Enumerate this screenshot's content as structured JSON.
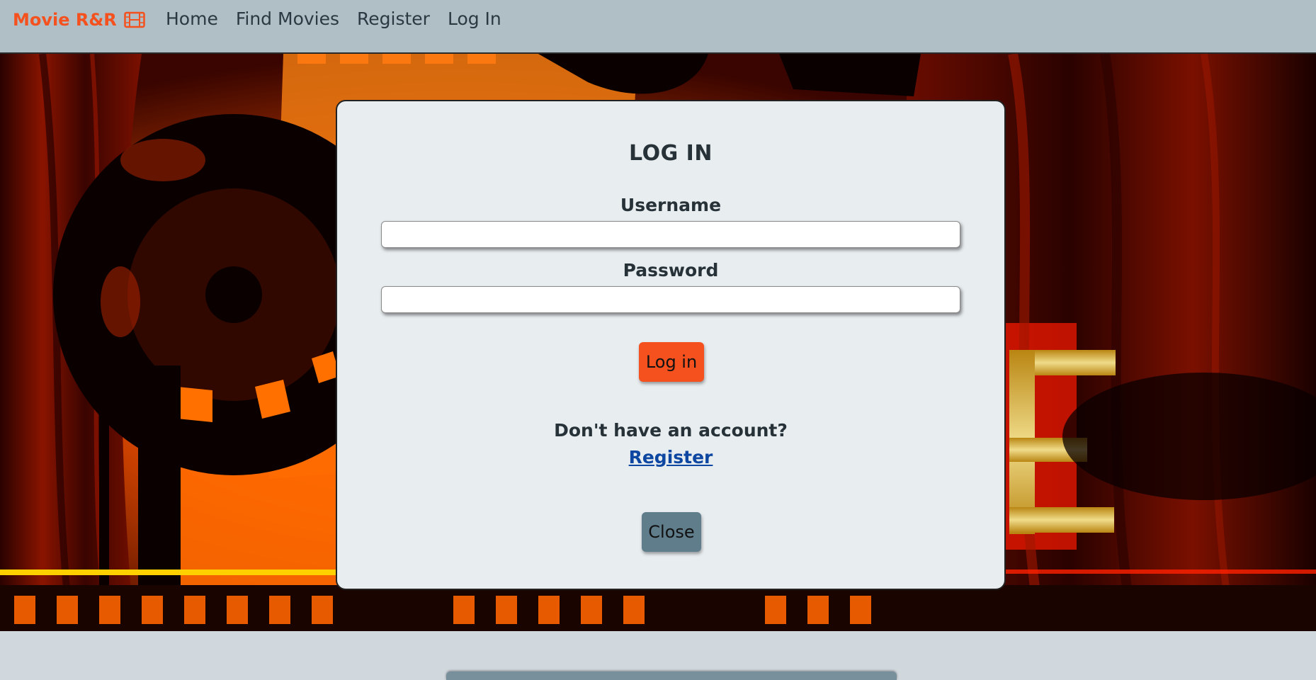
{
  "navbar": {
    "brand": "Movie R&R",
    "brand_icon": "film-icon",
    "links": [
      "Home",
      "Find Movies",
      "Register",
      "Log In"
    ]
  },
  "modal": {
    "title": "LOG IN",
    "username_label": "Username",
    "username_value": "",
    "password_label": "Password",
    "password_value": "",
    "login_button": "Log in",
    "no_account_text": "Don't have an account?",
    "register_link": "Register",
    "close_button": "Close"
  },
  "colors": {
    "accent": "#f4511e",
    "navbar_bg": "#b0bec5",
    "modal_bg": "#e8edf0",
    "close_button": "#607d8b",
    "link": "#0d47a1"
  }
}
